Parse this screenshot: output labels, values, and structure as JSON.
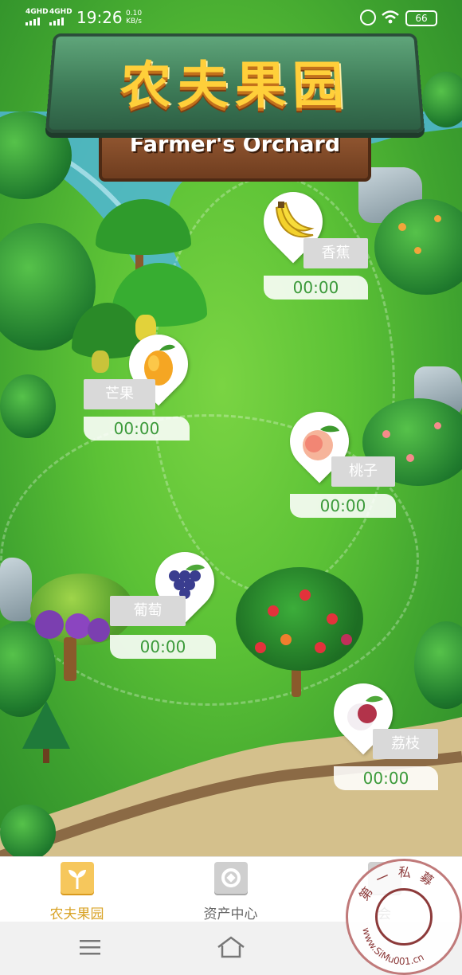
{
  "status_bar": {
    "network_1": "4GHD",
    "network_2": "4GHD",
    "time": "19:26",
    "speed_value": "0.10",
    "speed_unit": "KB/s",
    "battery": "66"
  },
  "banner": {
    "title": "农夫果园",
    "subtitle": "Farmer's Orchard"
  },
  "fruits": [
    {
      "name": "香蕉",
      "timer": "00:00",
      "icon": "banana-icon"
    },
    {
      "name": "芒果",
      "timer": "00:00",
      "icon": "mango-icon"
    },
    {
      "name": "桃子",
      "timer": "00:00",
      "icon": "peach-icon"
    },
    {
      "name": "葡萄",
      "timer": "00:00",
      "icon": "grape-icon"
    },
    {
      "name": "荔枝",
      "timer": "00:00",
      "icon": "lychee-icon"
    }
  ],
  "tabs": [
    {
      "label": "农夫果园",
      "icon": "sprout-icon",
      "active": true
    },
    {
      "label": "资产中心",
      "icon": "asset-icon",
      "active": false
    },
    {
      "label": "会",
      "icon": "member-icon",
      "active": false
    }
  ],
  "watermark": {
    "top_text": "第一私募",
    "bottom_text": "www.SiMu001.cn"
  },
  "colors": {
    "active_tab": "#d9a326",
    "inactive_tab": "#666666",
    "timer_text": "#3b9a3a"
  }
}
